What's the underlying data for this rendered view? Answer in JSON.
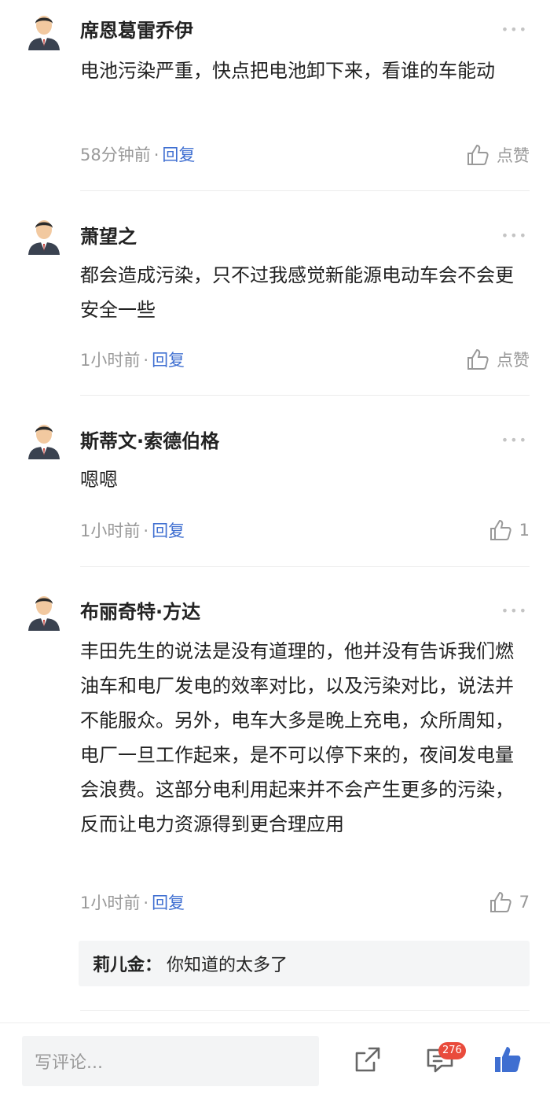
{
  "comments": [
    {
      "author": "席恩葛雷乔伊",
      "text": "电池污染严重，快点把电池卸下来，看谁的车能动",
      "time": "58分钟前",
      "dot": "·",
      "reply_label": "回复",
      "like_label": "点赞"
    },
    {
      "author": "萧望之",
      "text": "都会造成污染，只不过我感觉新能源电动车会不会更安全一些",
      "time": "1小时前",
      "dot": "·",
      "reply_label": "回复",
      "like_label": "点赞"
    },
    {
      "author": "斯蒂文·索德伯格",
      "text": "嗯嗯",
      "time": "1小时前",
      "dot": "·",
      "reply_label": "回复",
      "like_label": "1"
    },
    {
      "author": "布丽奇特·方达",
      "text": "丰田先生的说法是没有道理的，他并没有告诉我们燃油车和电厂发电的效率对比，以及污染对比，说法并不能服众。另外，电车大多是晚上充电，众所周知，电厂一旦工作起来，是不可以停下来的，夜间发电量会浪费。这部分电利用起来并不会产生更多的污染，反而让电力资源得到更合理应用",
      "time": "1小时前",
      "dot": "·",
      "reply_label": "回复",
      "like_label": "7",
      "sub_reply": {
        "author": "莉儿金：",
        "text": "你知道的太多了"
      }
    }
  ],
  "more_symbol": "•••",
  "bottom_bar": {
    "input_placeholder": "写评论...",
    "comment_count": "276"
  },
  "icons": {
    "avatar": "user-avatar-icon",
    "like": "thumbs-up-icon",
    "share": "share-icon",
    "comments": "comment-bubble-icon",
    "liked": "thumbs-up-filled-icon"
  },
  "colors": {
    "accent": "#3f6fd1",
    "badge": "#e94b3c",
    "muted": "#999999"
  }
}
